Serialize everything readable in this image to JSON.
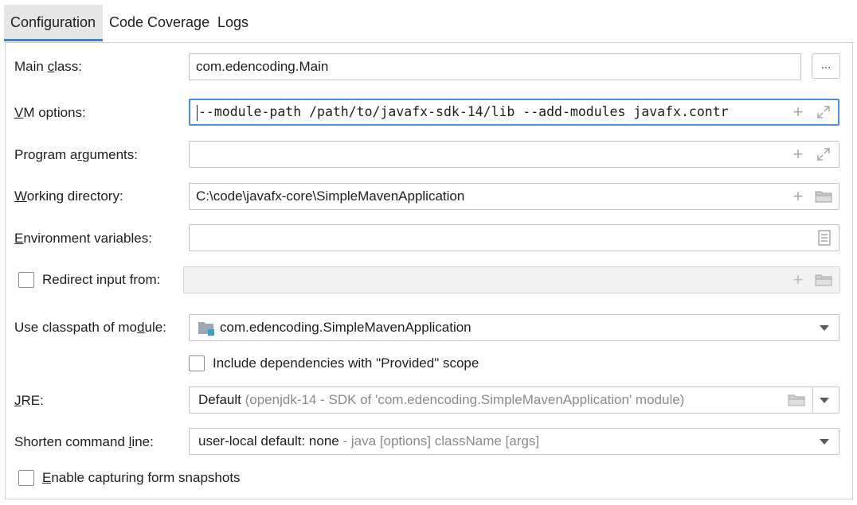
{
  "tabs": [
    {
      "label": "Configuration",
      "active": true
    },
    {
      "label": "Code Coverage",
      "active": false
    },
    {
      "label": "Logs",
      "active": false
    }
  ],
  "main_class": {
    "label_pre": "Main ",
    "label_u": "c",
    "label_post": "lass:",
    "value": "com.edencoding.Main",
    "browse_label": "..."
  },
  "vm_options": {
    "label_u": "V",
    "label_post": "M options:",
    "value": "--module-path /path/to/javafx-sdk-14/lib --add-modules javafx.contr"
  },
  "program_arguments": {
    "label_pre": "Program a",
    "label_u": "r",
    "label_post": "guments:",
    "value": ""
  },
  "working_directory": {
    "label_u": "W",
    "label_post": "orking directory:",
    "value": "C:\\code\\javafx-core\\SimpleMavenApplication"
  },
  "environment_variables": {
    "label_u": "E",
    "label_post": "nvironment variables:",
    "value": ""
  },
  "redirect_input": {
    "label": "Redirect input from:",
    "checked": false,
    "value": ""
  },
  "classpath_module": {
    "label_pre": "Use classpath of mo",
    "label_u": "d",
    "label_post": "ule:",
    "value": "com.edencoding.SimpleMavenApplication"
  },
  "include_dependencies": {
    "label": "Include dependencies with \"Provided\" scope",
    "checked": false
  },
  "jre": {
    "label_u": "J",
    "label_post": "RE:",
    "value_main": "Default",
    "value_detail": "(openjdk-14 - SDK of 'com.edencoding.SimpleMavenApplication' module)"
  },
  "shorten_command_line": {
    "label_pre": "Shorten command ",
    "label_u": "l",
    "label_post": "ine:",
    "value_main": "user-local default: none",
    "value_detail": "- java [options] className [args]"
  },
  "capture_snapshots": {
    "label_u": "E",
    "label_post": "nable capturing form snapshots",
    "checked": false
  },
  "colors": {
    "accent": "#4083c9",
    "focus": "#4d8fd6",
    "icon": "#a8a8a8"
  }
}
